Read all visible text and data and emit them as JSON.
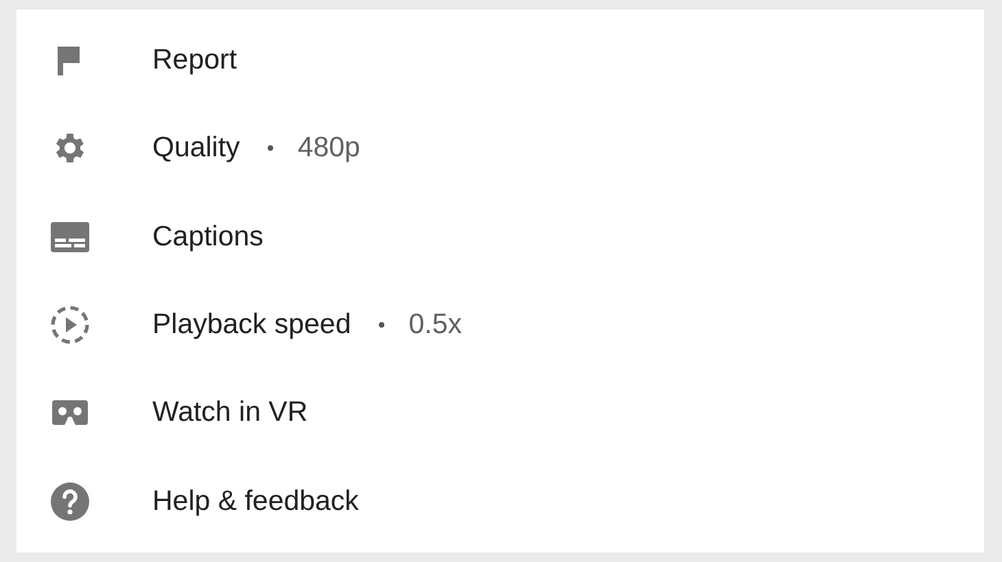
{
  "menu": {
    "items": [
      {
        "label": "Report"
      },
      {
        "label": "Quality",
        "value": "480p"
      },
      {
        "label": "Captions"
      },
      {
        "label": "Playback speed",
        "value": "0.5x"
      },
      {
        "label": "Watch in VR"
      },
      {
        "label": "Help & feedback"
      }
    ]
  }
}
